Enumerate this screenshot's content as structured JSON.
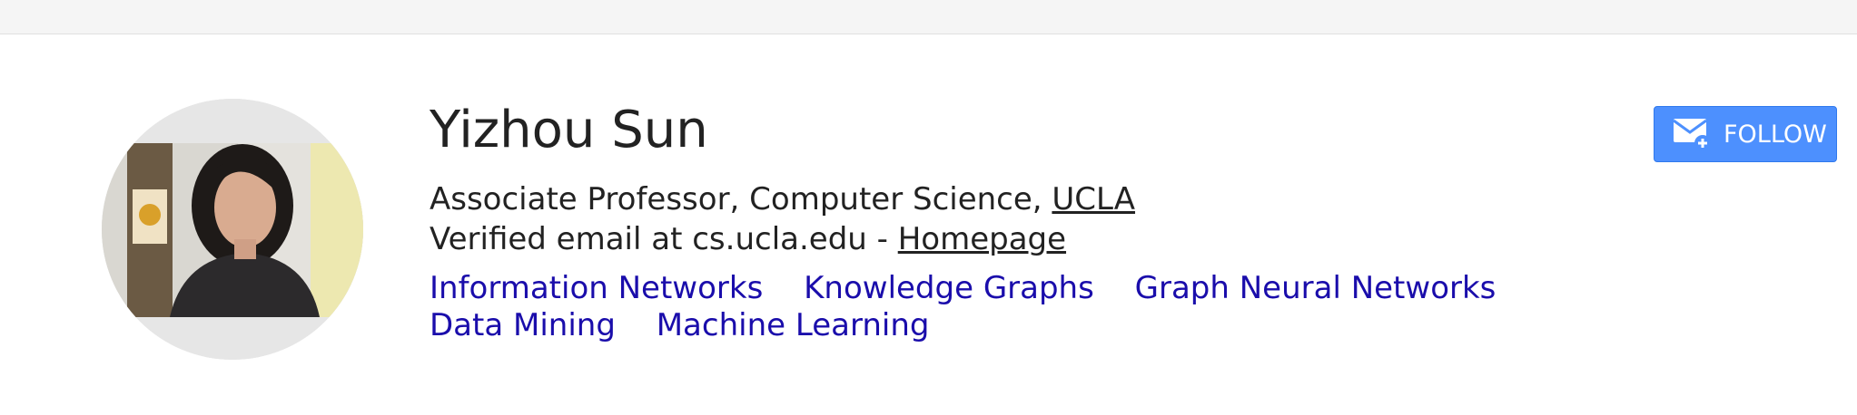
{
  "profile": {
    "name": "Yizhou Sun",
    "affiliation_prefix": "Associate Professor, Computer Science, ",
    "affiliation_link": "UCLA",
    "email_prefix": "Verified email at cs.ucla.edu - ",
    "homepage_link": "Homepage",
    "interests": [
      "Information Networks",
      "Knowledge Graphs",
      "Graph Neural Networks",
      "Data Mining",
      "Machine Learning"
    ]
  },
  "follow_button": {
    "label": "FOLLOW",
    "icon": "mail-plus-icon"
  },
  "colors": {
    "link": "#1a0dab",
    "button": "#4d90fe",
    "topbar": "#f5f5f5"
  }
}
